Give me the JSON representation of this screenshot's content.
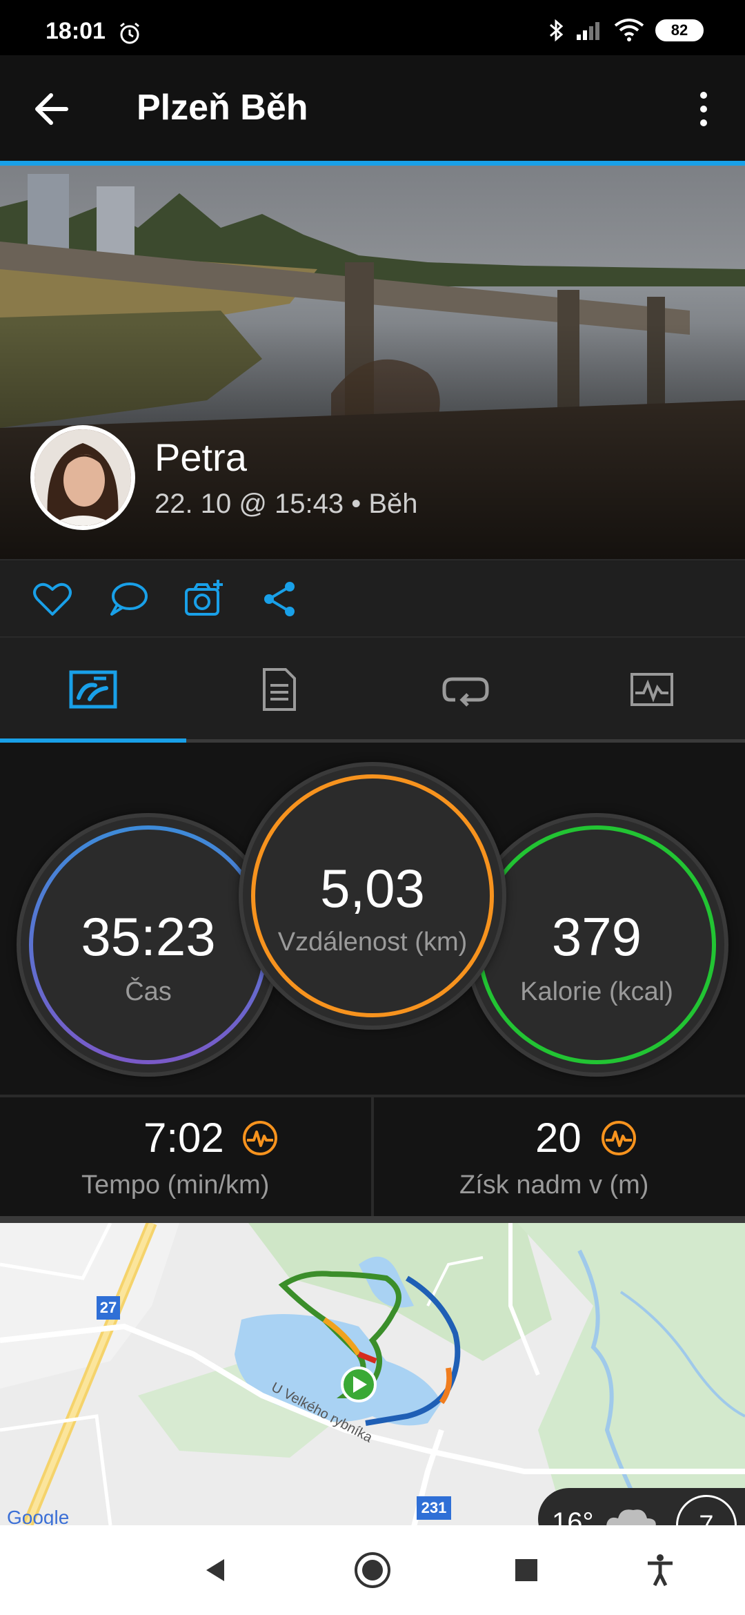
{
  "status_bar": {
    "time": "18:01",
    "battery": "82"
  },
  "toolbar": {
    "title": "Plzeň Běh"
  },
  "activity": {
    "user_name": "Petra",
    "meta": "22. 10 @ 15:43 • Běh"
  },
  "tabs": [
    {
      "name": "summary",
      "active": true
    },
    {
      "name": "details",
      "active": false
    },
    {
      "name": "laps",
      "active": false
    },
    {
      "name": "charts",
      "active": false
    }
  ],
  "stats": {
    "time": {
      "value": "35:23",
      "label": "Čas"
    },
    "distance": {
      "value": "5,03",
      "label": "Vzdálenost (km)"
    },
    "calories": {
      "value": "379",
      "label": "Kalorie (kcal)"
    }
  },
  "secondary": {
    "pace": {
      "value": "7:02",
      "label": "Tempo (min/km)"
    },
    "elevation": {
      "value": "20",
      "label": "Získ nadm v (m)"
    }
  },
  "map": {
    "road_badge_1": "27",
    "road_badge_2": "231",
    "street_label": "U Velkého rybníka",
    "provider_label": "Google"
  },
  "weather": {
    "temp": "16°",
    "badge": "7"
  },
  "colors": {
    "accent": "#19a0e8",
    "time_ring": "#3d8bd9",
    "distance_ring": "#f7931e",
    "calories_ring": "#22c433"
  }
}
